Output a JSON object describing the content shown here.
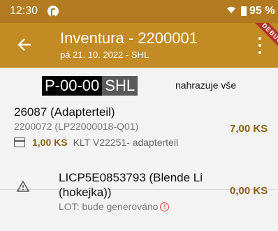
{
  "status_bar": {
    "time": "12:30",
    "battery": "95 %"
  },
  "app_bar": {
    "title": "Inventura - 2200001",
    "subtitle": "pá 21. 10. 2022 - SHL",
    "debug_label": "DEBUG"
  },
  "location": {
    "code": "P-00-00",
    "warehouse": "SHL",
    "replace_all_label": "nahrazuje vše"
  },
  "items": [
    {
      "name": "26087 (Adapterteil)",
      "subtitle": "2200072 (LP22000018-Q01)",
      "quantity": "7,00 KS",
      "package_quantity": "1,00 KS",
      "package_label": "KLT V22251- adapterteil"
    },
    {
      "name": "LICP5E0853793 (Blende Li (hokejka))",
      "lot": "LOT: bude generováno",
      "quantity": "0,00 KS"
    }
  ],
  "colors": {
    "status_bar": "#b27b1f",
    "app_bar": "#c38b23",
    "quantity": "#8a5e16",
    "error": "#d64535"
  }
}
